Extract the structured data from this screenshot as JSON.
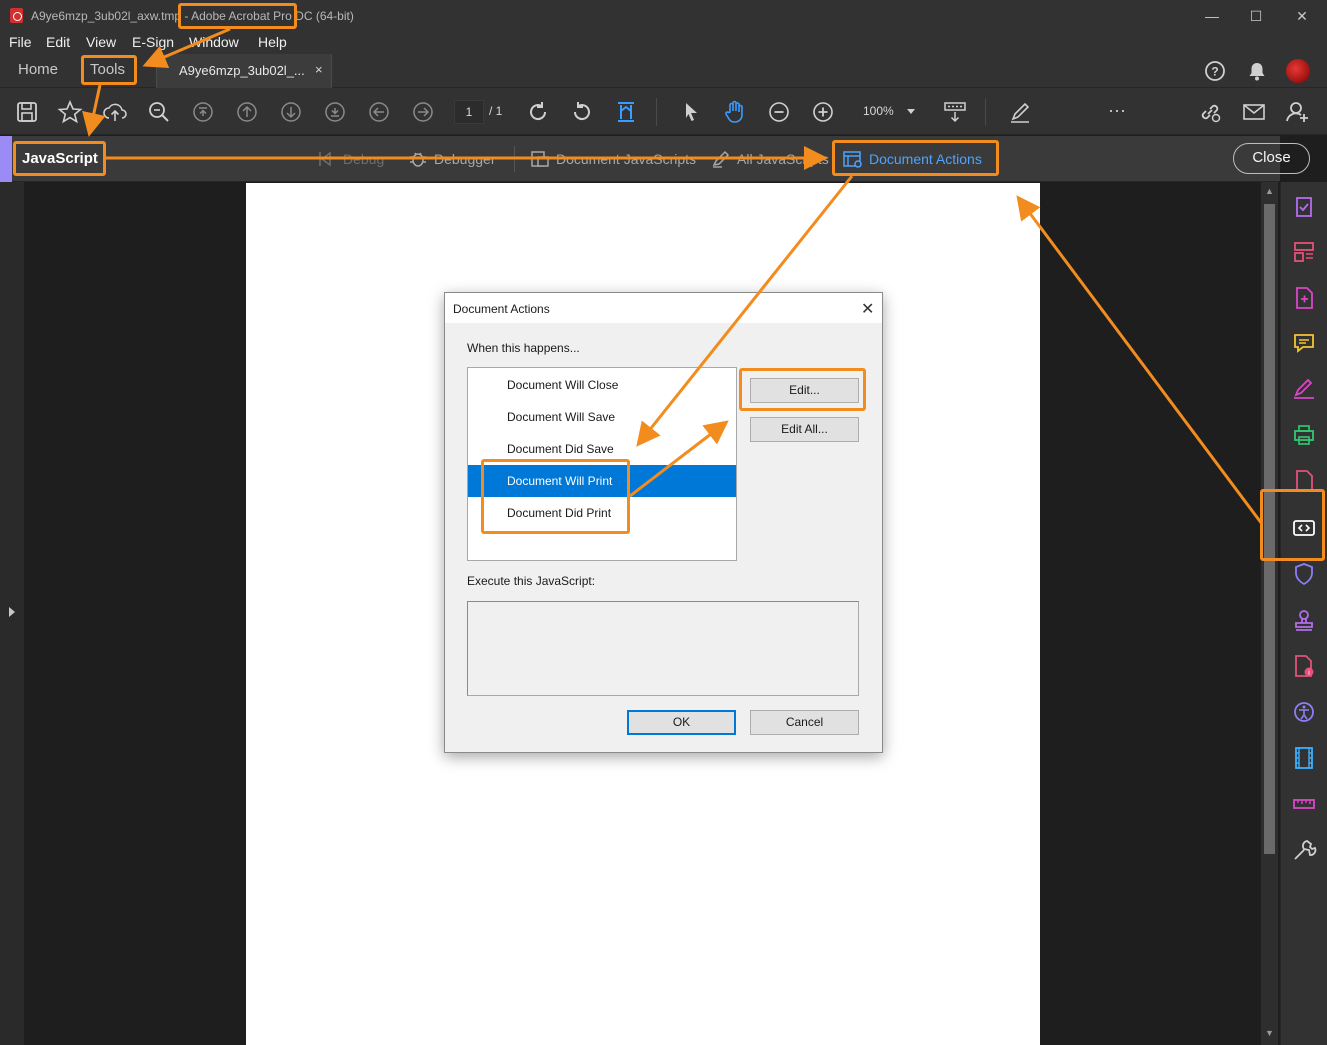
{
  "window": {
    "title_file": "A9ye6mzp_3ub02l_axw.tmp",
    "title_app": " - Adobe Acrobat Pro DC (64-bit)",
    "controls": {
      "minimize": "—",
      "maximize": "☐",
      "close": "✕"
    }
  },
  "menu": [
    "File",
    "Edit",
    "View",
    "E-Sign",
    "Window",
    "Help"
  ],
  "tabs": {
    "home": "Home",
    "tools": "Tools",
    "document": "A9ye6mzp_3ub02l_...",
    "document_close": "×"
  },
  "toolbar": {
    "page_current": "1",
    "page_total": "/ 1",
    "zoom": "100%",
    "more": "···"
  },
  "js_bar": {
    "label": "JavaScript",
    "items": [
      "Debug",
      "Debugger",
      "Document JavaScripts",
      "All JavaScripts",
      "Document Actions"
    ],
    "close": "Close"
  },
  "dialog": {
    "title": "Document Actions",
    "close": "✕",
    "when_label": "When this happens...",
    "events": [
      "Document Will Close",
      "Document Will Save",
      "Document Did Save",
      "Document Will Print",
      "Document Did Print"
    ],
    "selected_event_index": 3,
    "edit": "Edit...",
    "edit_all": "Edit All...",
    "execute_label": "Execute this JavaScript:",
    "ok": "OK",
    "cancel": "Cancel"
  },
  "colors": {
    "annotation": "#f28c1e",
    "selection": "#0078d7",
    "js_accent": "#9a8cf4",
    "right_panel_active": "#7b6cf0"
  },
  "right_panel_icons": [
    "checklist-icon",
    "organize-pages-icon",
    "export-pdf-icon",
    "comment-icon",
    "fill-sign-icon",
    "print-production-icon",
    "create-pdf-icon",
    "javascript-icon",
    "protect-icon",
    "stamp-icon",
    "pdf-standards-icon",
    "accessibility-icon",
    "rich-media-icon",
    "measure-icon",
    "action-wizard-icon"
  ]
}
